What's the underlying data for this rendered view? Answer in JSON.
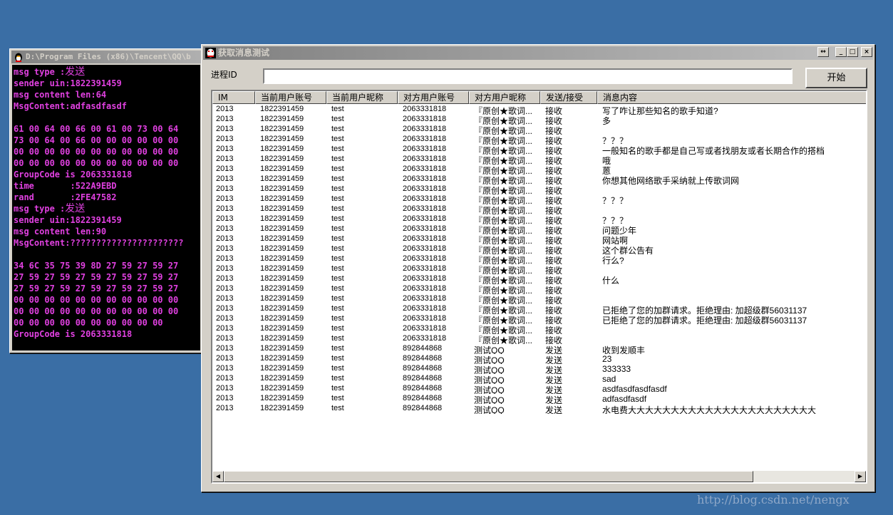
{
  "console": {
    "title": "D:\\Program Files (x86)\\Tencent\\QQ\\b",
    "lines": [
      {
        "pre": "msg type :",
        "cjk": "发送"
      },
      {
        "pre": "sender uin:1822391459"
      },
      {
        "pre": "msg content len:64"
      },
      {
        "pre": "MsgContent:adfasdfasdf"
      },
      {
        "pre": ""
      },
      {
        "pre": "61 00 64 00 66 00 61 00 73 00 64"
      },
      {
        "pre": "73 00 64 00 66 00 00 00 00 00 00"
      },
      {
        "pre": "00 00 00 00 00 00 00 00 00 00 00"
      },
      {
        "pre": "00 00 00 00 00 00 00 00 00 00 00"
      },
      {
        "pre": "GroupCode is 2063331818"
      },
      {
        "pre": "time       :522A9EBD"
      },
      {
        "pre": "rand       :2FE47582"
      },
      {
        "pre": "msg type :",
        "cjk": "发送"
      },
      {
        "pre": "sender uin:1822391459"
      },
      {
        "pre": "msg content len:90"
      },
      {
        "pre": "MsgContent:??????????????????????"
      },
      {
        "pre": ""
      },
      {
        "pre": "34 6C 35 75 39 8D 27 59 27 59 27"
      },
      {
        "pre": "27 59 27 59 27 59 27 59 27 59 27"
      },
      {
        "pre": "27 59 27 59 27 59 27 59 27 59 27"
      },
      {
        "pre": "00 00 00 00 00 00 00 00 00 00 00"
      },
      {
        "pre": "00 00 00 00 00 00 00 00 00 00 00"
      },
      {
        "pre": "00 00 00 00 00 00 00 00 00 00"
      },
      {
        "pre": "GroupCode is 2063331818"
      }
    ]
  },
  "dialog": {
    "title": "获取消息测试",
    "pid_label": "进程ID",
    "pid_value": "",
    "start_label": "开始",
    "btn_restore": "↔",
    "btn_min": "_",
    "btn_max": "□",
    "btn_close": "×",
    "columns": [
      "IM",
      "当前用户账号",
      "当前用户昵称",
      "对方用户账号",
      "对方用户昵称",
      "发送/接受",
      "消息内容"
    ],
    "rows": [
      [
        "2013",
        "1822391459",
        "test",
        "2063331818",
        "『原创★歌词...",
        "接收",
        "写了咋让那些知名的歌手知道?"
      ],
      [
        "2013",
        "1822391459",
        "test",
        "2063331818",
        "『原创★歌词...",
        "接收",
        "多"
      ],
      [
        "2013",
        "1822391459",
        "test",
        "2063331818",
        "『原创★歌词...",
        "接收",
        ""
      ],
      [
        "2013",
        "1822391459",
        "test",
        "2063331818",
        "『原创★歌词...",
        "接收",
        "？？？"
      ],
      [
        "2013",
        "1822391459",
        "test",
        "2063331818",
        "『原创★歌词...",
        "接收",
        "一般知名的歌手都是自己写或者找朋友或者长期合作的搭档"
      ],
      [
        "2013",
        "1822391459",
        "test",
        "2063331818",
        "『原创★歌词...",
        "接收",
        "哦"
      ],
      [
        "2013",
        "1822391459",
        "test",
        "2063331818",
        "『原创★歌词...",
        "接收",
        "蒽"
      ],
      [
        "2013",
        "1822391459",
        "test",
        "2063331818",
        "『原创★歌词...",
        "接收",
        "你想其他网络歌手采纳就上传歌词网"
      ],
      [
        "2013",
        "1822391459",
        "test",
        "2063331818",
        "『原创★歌词...",
        "接收",
        ""
      ],
      [
        "2013",
        "1822391459",
        "test",
        "2063331818",
        "『原创★歌词...",
        "接收",
        "？？？"
      ],
      [
        "2013",
        "1822391459",
        "test",
        "2063331818",
        "『原创★歌词...",
        "接收",
        ""
      ],
      [
        "2013",
        "1822391459",
        "test",
        "2063331818",
        "『原创★歌词...",
        "接收",
        "？？？"
      ],
      [
        "2013",
        "1822391459",
        "test",
        "2063331818",
        "『原创★歌词...",
        "接收",
        "问题少年"
      ],
      [
        "2013",
        "1822391459",
        "test",
        "2063331818",
        "『原创★歌词...",
        "接收",
        "网站啊"
      ],
      [
        "2013",
        "1822391459",
        "test",
        "2063331818",
        "『原创★歌词...",
        "接收",
        "这个群公告有"
      ],
      [
        "2013",
        "1822391459",
        "test",
        "2063331818",
        "『原创★歌词...",
        "接收",
        "行么?"
      ],
      [
        "2013",
        "1822391459",
        "test",
        "2063331818",
        "『原创★歌词...",
        "接收",
        ""
      ],
      [
        "2013",
        "1822391459",
        "test",
        "2063331818",
        "『原创★歌词...",
        "接收",
        "什么"
      ],
      [
        "2013",
        "1822391459",
        "test",
        "2063331818",
        "『原创★歌词...",
        "接收",
        ""
      ],
      [
        "2013",
        "1822391459",
        "test",
        "2063331818",
        "『原创★歌词...",
        "接收",
        ""
      ],
      [
        "2013",
        "1822391459",
        "test",
        "2063331818",
        "『原创★歌词...",
        "接收",
        "已拒绝了您的加群请求。拒绝理由: 加超级群56031137"
      ],
      [
        "2013",
        "1822391459",
        "test",
        "2063331818",
        "『原创★歌词...",
        "接收",
        "已拒绝了您的加群请求。拒绝理由: 加超级群56031137"
      ],
      [
        "2013",
        "1822391459",
        "test",
        "2063331818",
        "『原创★歌词...",
        "接收",
        ""
      ],
      [
        "2013",
        "1822391459",
        "test",
        "2063331818",
        "『原创★歌词...",
        "接收",
        ""
      ],
      [
        "2013",
        "1822391459",
        "test",
        "892844868",
        "测试QQ",
        "发送",
        "收到发顺丰"
      ],
      [
        "2013",
        "1822391459",
        "test",
        "892844868",
        "测试QQ",
        "发送",
        "23"
      ],
      [
        "2013",
        "1822391459",
        "test",
        "892844868",
        "测试QQ",
        "发送",
        "333333"
      ],
      [
        "2013",
        "1822391459",
        "test",
        "892844868",
        "测试QQ",
        "发送",
        "sad"
      ],
      [
        "2013",
        "1822391459",
        "test",
        "892844868",
        "测试QQ",
        "发送",
        "asdfasdfasdfasdf"
      ],
      [
        "2013",
        "1822391459",
        "test",
        "892844868",
        "测试QQ",
        "发送",
        "adfasdfasdf"
      ],
      [
        "2013",
        "1822391459",
        "test",
        "892844868",
        "测试QQ",
        "发送",
        "水电费大大大大大大大大大大大大大大大大大大大大大大"
      ]
    ],
    "scroll_left": "◀",
    "scroll_right": "▶"
  },
  "watermark": "http://blog.csdn.net/nengx",
  "colors": {
    "desktop": "#3a6ea5",
    "console_text": "#e040e0",
    "title_inactive": "#808080"
  }
}
